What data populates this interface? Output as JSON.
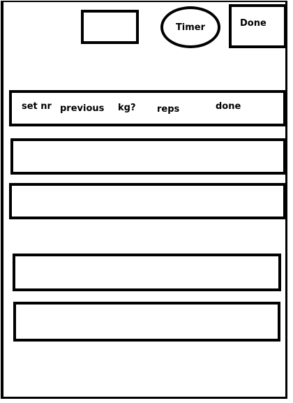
{
  "toolbar": {
    "timer_label": "Timer",
    "done_label": "Done"
  },
  "table": {
    "headers": {
      "set_nr": "set nr",
      "previous": "previous",
      "kg": "kg?",
      "reps": "reps",
      "done": "done"
    }
  }
}
